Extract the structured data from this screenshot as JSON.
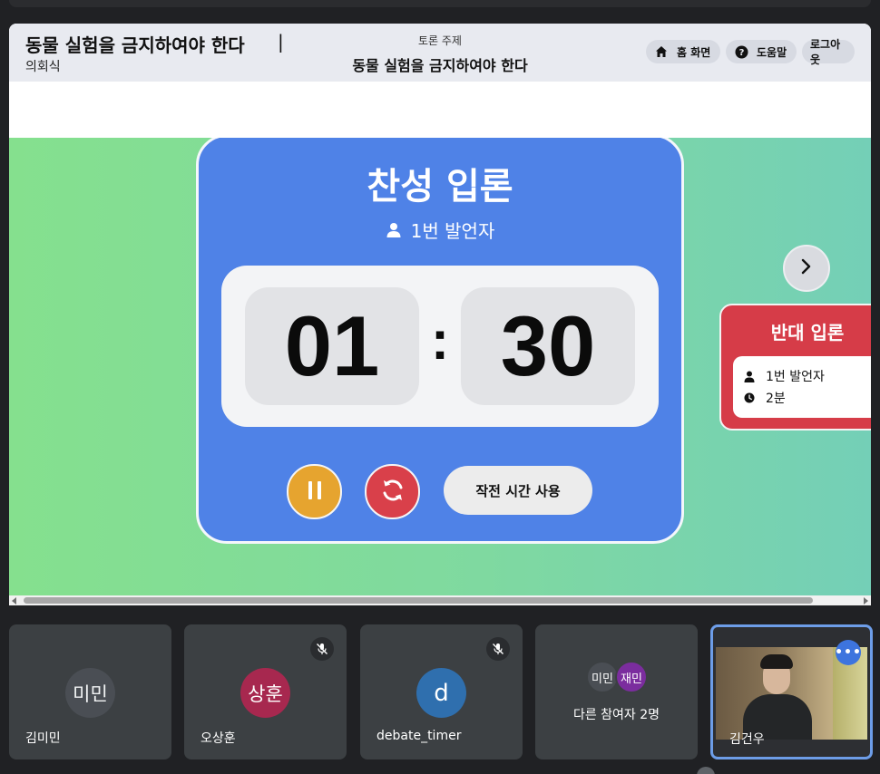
{
  "header": {
    "title": "동물 실험을 금지하여야 한다",
    "title_separator": "|",
    "format": "의회식",
    "topic_label": "토론 주제",
    "topic_title": "동물 실험을 금지하여야 한다"
  },
  "nav": {
    "home_label": "홈 화면",
    "home_icon": "home-icon",
    "help_label": "도움말",
    "help_icon": "help-icon",
    "logout_label": "로그아웃"
  },
  "timer_card": {
    "phase": "찬성 입론",
    "speaker": "1번 발언자",
    "minutes": "01",
    "seconds": "30",
    "colon": ":",
    "color": "#4f82e7"
  },
  "controls": {
    "pause_icon": "pause-icon",
    "pause_color": "#e6a42f",
    "reset_icon": "reset-icon",
    "reset_color": "#d9404a",
    "strategy_label": "작전 시간 사용"
  },
  "next_phase": {
    "title": "반대 입론",
    "speaker": "1번 발언자",
    "duration": "2분",
    "color": "#d63c48"
  },
  "participants": [
    {
      "initials": "미민",
      "name": "김미민",
      "muted": false
    },
    {
      "initials": "상훈",
      "name": "오상훈",
      "muted": true
    },
    {
      "initials": "d",
      "name": "debate_timer",
      "muted": true
    }
  ],
  "others": {
    "avatars": [
      "미민",
      "재민"
    ],
    "label": "다른 참여자 2명"
  },
  "self_tile": {
    "name": "김건우",
    "more_icon": "more-options-icon"
  }
}
